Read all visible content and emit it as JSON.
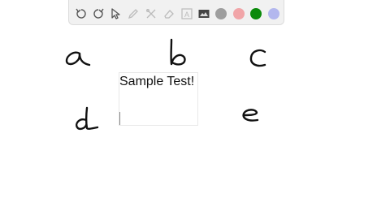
{
  "toolbar": {
    "tools": [
      "undo-icon",
      "redo-icon",
      "select-pointer-icon",
      "pen-icon",
      "shapes-icon",
      "eraser-icon",
      "text-icon",
      "image-icon"
    ],
    "colors": [
      {
        "name": "gray",
        "hex": "#9e9e9e"
      },
      {
        "name": "pink",
        "hex": "#f1a5a8"
      },
      {
        "name": "green",
        "hex": "#0a8a0a"
      },
      {
        "name": "lavender",
        "hex": "#b3b7ee"
      }
    ]
  },
  "canvas": {
    "handwritten_letters": [
      "a",
      "b",
      "c",
      "d",
      "e"
    ],
    "textbox": {
      "text": "Sample Test!"
    }
  }
}
